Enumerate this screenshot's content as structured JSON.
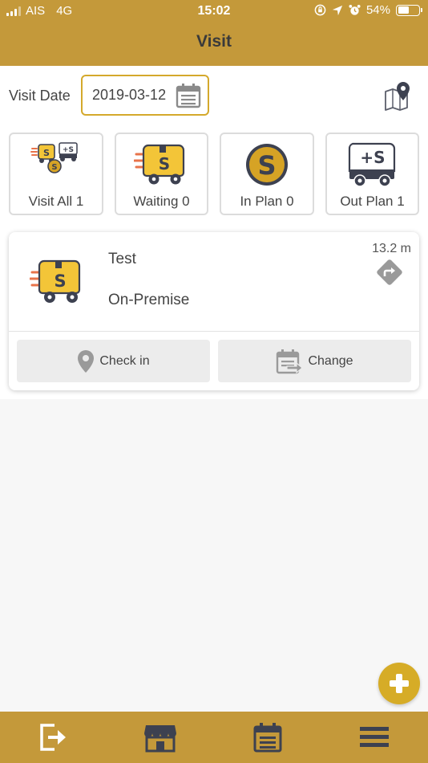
{
  "status_bar": {
    "carrier": "AIS",
    "network": "4G",
    "time": "15:02",
    "battery": "54%",
    "battery_level": 0.54
  },
  "header": {
    "title": "Visit"
  },
  "visit_date": {
    "label": "Visit Date",
    "value": "2019-03-12"
  },
  "categories": [
    {
      "label": "Visit All 1",
      "icon": "visit-all-icon"
    },
    {
      "label": "Waiting 0",
      "icon": "delivery-truck-icon"
    },
    {
      "label": "In Plan 0",
      "icon": "s-coin-icon"
    },
    {
      "label": "Out Plan 1",
      "icon": "plus-s-truck-icon"
    }
  ],
  "visit_card": {
    "name": "Test",
    "type": "On-Premise",
    "distance": "13.2 m",
    "check_in_label": "Check in",
    "change_label": "Change"
  },
  "bottom_nav": [
    {
      "icon": "logout-icon"
    },
    {
      "icon": "store-icon"
    },
    {
      "icon": "calendar-icon"
    },
    {
      "icon": "menu-icon"
    }
  ],
  "colors": {
    "brand": "#c4993a",
    "accent": "#d6ac27",
    "truck_yellow": "#f3c538",
    "dark": "#3d4150"
  }
}
